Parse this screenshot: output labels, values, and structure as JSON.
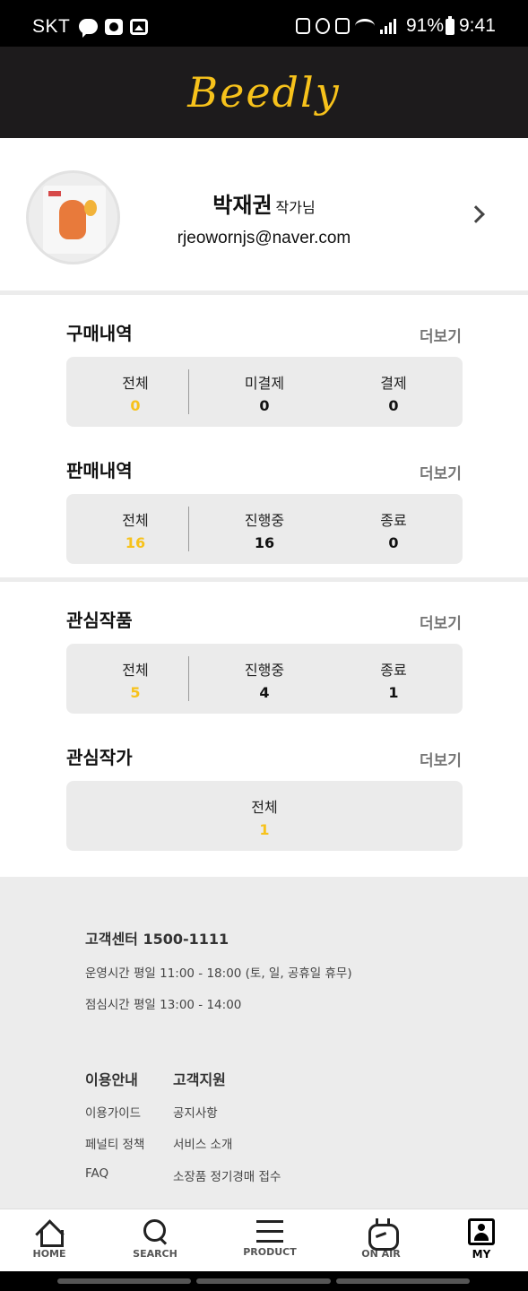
{
  "status_bar": {
    "carrier": "SKT",
    "battery": "91%",
    "time": "9:41"
  },
  "header": {
    "logo": "Beedly",
    "logo_color": "#f7c21b",
    "background": "#1d1b1c"
  },
  "profile": {
    "name": "박재권",
    "suffix": "작가님",
    "email": "rjeowornjs@naver.com"
  },
  "sections": {
    "purchases": {
      "title": "구매내역",
      "more": "더보기",
      "stats": [
        {
          "label": "전체",
          "value": "0"
        },
        {
          "label": "미결제",
          "value": "0"
        },
        {
          "label": "결제",
          "value": "0"
        }
      ]
    },
    "sales": {
      "title": "판매내역",
      "more": "더보기",
      "stats": [
        {
          "label": "전체",
          "value": "16"
        },
        {
          "label": "진행중",
          "value": "16"
        },
        {
          "label": "종료",
          "value": "0"
        }
      ]
    },
    "liked_works": {
      "title": "관심작품",
      "more": "더보기",
      "stats": [
        {
          "label": "전체",
          "value": "5"
        },
        {
          "label": "진행중",
          "value": "4"
        },
        {
          "label": "종료",
          "value": "1"
        }
      ]
    },
    "liked_artists": {
      "title": "관심작가",
      "more": "더보기",
      "stats": [
        {
          "label": "전체",
          "value": "1"
        }
      ]
    }
  },
  "footer": {
    "customer_center": "고객센터 1500-1111",
    "hours": "운영시간 평일 11:00 - 18:00 (토, 일, 공휴일 휴무)",
    "lunch": "점심시간 평일 13:00 - 14:00",
    "col1_title": "이용안내",
    "col1_items": [
      "이용가이드",
      "페널티 정책",
      "FAQ"
    ],
    "col2_title": "고객지원",
    "col2_items": [
      "공지사항",
      "서비스 소개",
      "소장품 정기경매 접수"
    ]
  },
  "bottom_nav": {
    "items": [
      {
        "label": "HOME",
        "icon": "home-icon"
      },
      {
        "label": "SEARCH",
        "icon": "search-icon"
      },
      {
        "label": "PRODUCT",
        "icon": "menu-icon"
      },
      {
        "label": "ON AIR",
        "icon": "tv-icon"
      },
      {
        "label": "MY",
        "icon": "profile-icon"
      }
    ],
    "active": "MY"
  }
}
